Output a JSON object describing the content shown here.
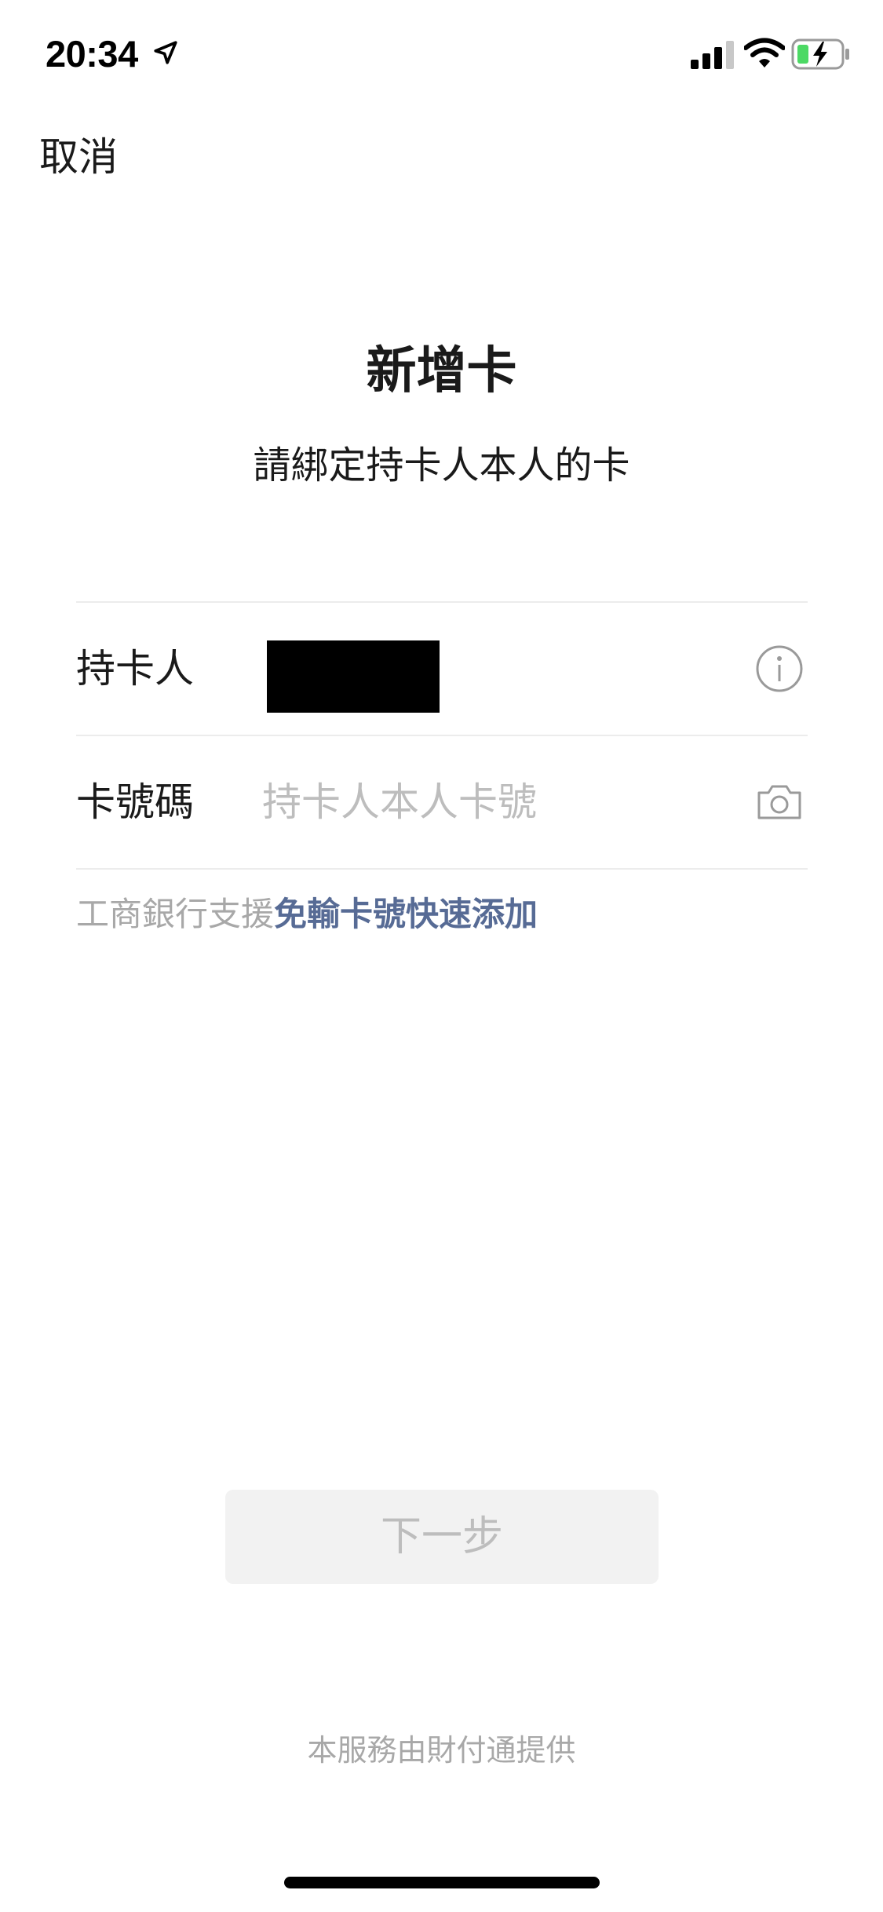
{
  "status_bar": {
    "time": "20:34",
    "icons": [
      "location-arrow-icon",
      "cellular-signal-icon",
      "wifi-icon",
      "battery-charging-icon"
    ],
    "battery_color": "#4cd964"
  },
  "nav": {
    "cancel_label": "取消"
  },
  "header": {
    "title": "新增卡",
    "subtitle": "請綁定持卡人本人的卡"
  },
  "form": {
    "cardholder": {
      "label": "持卡人",
      "value": "",
      "icon": "info-icon"
    },
    "card_number": {
      "label": "卡號碼",
      "value": "",
      "placeholder": "持卡人本人卡號",
      "icon": "camera-icon"
    }
  },
  "quick_add": {
    "prefix": "工商銀行支援",
    "link": "免輸卡號快速添加",
    "link_color": "#576b95"
  },
  "next_button": {
    "label": "下一步"
  },
  "footer": {
    "text": "本服務由財付通提供"
  }
}
